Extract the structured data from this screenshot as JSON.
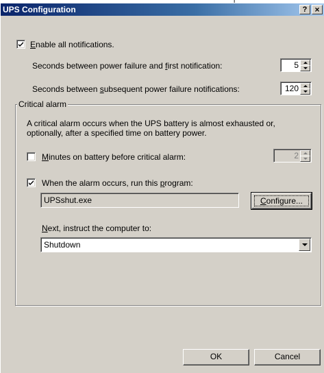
{
  "window": {
    "title": "UPS Configuration",
    "help_button": "?",
    "close_button": "×",
    "top_mark": "["
  },
  "notifications": {
    "enable_label_accel": "E",
    "enable_label_rest": "nable all notifications.",
    "enable_checked": true,
    "first_label_a": "Seconds between power failure and ",
    "first_label_accel": "f",
    "first_label_b": "irst notification:",
    "first_value": "5",
    "subsequent_label_a": "Seconds between ",
    "subsequent_label_accel": "s",
    "subsequent_label_b": "ubsequent power failure notifications:",
    "subsequent_value": "120"
  },
  "critical_alarm": {
    "group_label": "Critical alarm",
    "description_line1": "A critical alarm occurs when the UPS battery is almost exhausted or,",
    "description_line2": "optionally, after a specified time on battery power.",
    "minutes_label_accel": "M",
    "minutes_label_rest": "inutes on battery before critical alarm:",
    "minutes_checked": false,
    "minutes_value": "2",
    "run_label_a": "When the alarm occurs, run this ",
    "run_label_accel": "p",
    "run_label_b": "rogram:",
    "run_checked": true,
    "program_name": "UPSshut.exe",
    "configure_accel": "C",
    "configure_rest": "onfigure...",
    "next_label_accel": "N",
    "next_label_rest": "ext, instruct the computer to:",
    "next_selected": "Shutdown"
  },
  "footer": {
    "ok_label": "OK",
    "cancel_label": "Cancel"
  }
}
